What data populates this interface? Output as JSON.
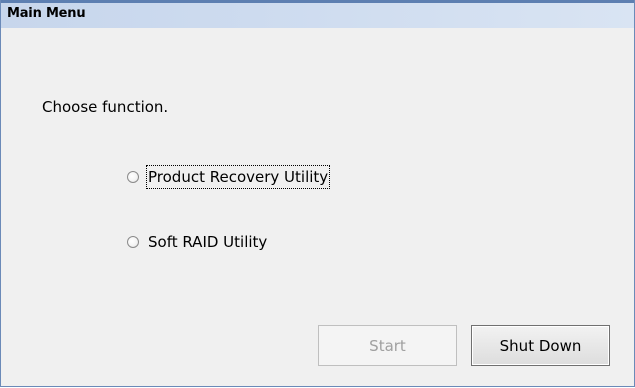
{
  "window": {
    "title": "Main Menu"
  },
  "prompt": "Choose function.",
  "options": [
    {
      "label": "Product Recovery Utility",
      "selected": false,
      "focused": true
    },
    {
      "label": "Soft RAID Utility",
      "selected": false,
      "focused": false
    }
  ],
  "buttons": {
    "start": {
      "label": "Start",
      "enabled": false
    },
    "shutdown": {
      "label": "Shut Down",
      "enabled": true
    }
  },
  "colors": {
    "titlebar": "#cddbef",
    "title_border": "#5d7fb1",
    "background": "#f0f0f0",
    "disabled_text": "#a0a0a0"
  }
}
